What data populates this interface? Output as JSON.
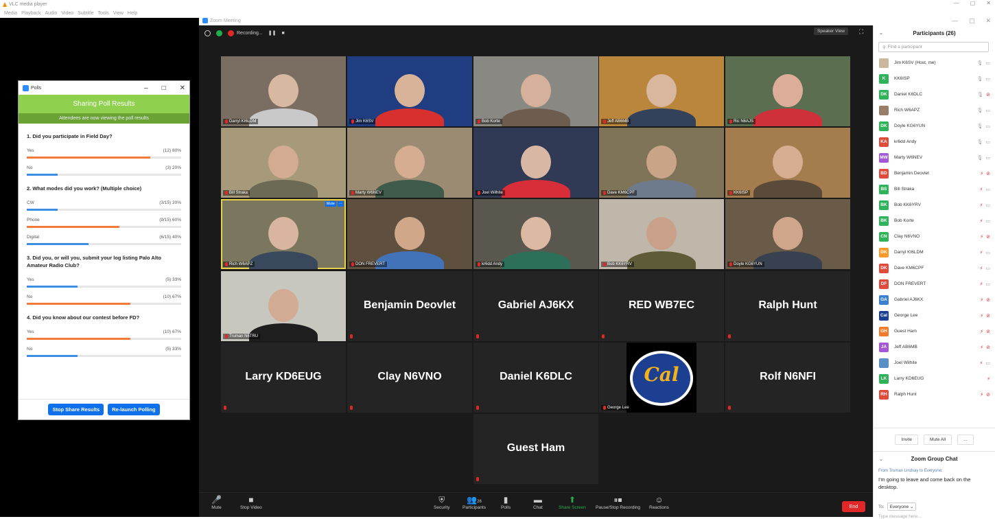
{
  "vlc": {
    "title": "VLC media player",
    "menu": [
      "Media",
      "Playback",
      "Audio",
      "Video",
      "Subtitle",
      "Tools",
      "View",
      "Help"
    ]
  },
  "polls": {
    "window_title": "Polls",
    "header": "Sharing Poll Results",
    "subheader": "Attendees are now viewing the poll results",
    "questions": [
      {
        "q": "1. Did you participate in Field Day?",
        "options": [
          {
            "label": "Yes",
            "result": "(12) 80%",
            "fraction": 0.8,
            "color": "#f27a3a"
          },
          {
            "label": "No",
            "result": "(3) 20%",
            "fraction": 0.2,
            "color": "#3a8de0"
          }
        ]
      },
      {
        "q": "2. What modes did you work? (Multiple choice)",
        "options": [
          {
            "label": "CW",
            "result": "(3/15) 20%",
            "fraction": 0.2,
            "color": "#3a8de0"
          },
          {
            "label": "Phone",
            "result": "(9/15) 60%",
            "fraction": 0.6,
            "color": "#f27a3a"
          },
          {
            "label": "Digital",
            "result": "(6/15) 40%",
            "fraction": 0.4,
            "color": "#3a8de0"
          }
        ]
      },
      {
        "q": "3. Did you, or will you, submit your log listing Palo Alto Amateur Radio Club?",
        "options": [
          {
            "label": "Yes",
            "result": "(5) 33%",
            "fraction": 0.33,
            "color": "#3a8de0"
          },
          {
            "label": "No",
            "result": "(10) 67%",
            "fraction": 0.67,
            "color": "#f27a3a"
          }
        ]
      },
      {
        "q": "4. Did you know about our contest before FD?",
        "options": [
          {
            "label": "Yes",
            "result": "(10) 67%",
            "fraction": 0.67,
            "color": "#f27a3a"
          },
          {
            "label": "No",
            "result": "(5) 33%",
            "fraction": 0.33,
            "color": "#3a8de0"
          }
        ]
      }
    ],
    "buttons": {
      "stop": "Stop Share Results",
      "relaunch": "Re-launch Polling"
    }
  },
  "zoom": {
    "window_title": "Zoom Meeting",
    "recording": "Recording...",
    "speaker_view": "Speaker View",
    "tiles": [
      {
        "type": "video",
        "name": "Darryl KI6LDM",
        "bg": "#7a6e62",
        "skin": "#d7b8a0",
        "shirt": "#c9c9c9"
      },
      {
        "type": "video",
        "name": "Jim K6SV",
        "bg": "#1f3d80",
        "skin": "#d8b39a",
        "shirt": "#d8302f"
      },
      {
        "type": "video",
        "name": "Bob Korte",
        "bg": "#8a8882",
        "skin": "#d5b09a",
        "shirt": "#6c5d4f"
      },
      {
        "type": "video",
        "name": "Jeff AB6MB",
        "bg": "#b9863c",
        "skin": "#d9b79f",
        "shirt": "#33425a"
      },
      {
        "type": "video",
        "name": "Ric N6AJS",
        "bg": "#5c6e50",
        "skin": "#dcae9a",
        "shirt": "#d0303a"
      },
      {
        "type": "video",
        "name": "Bill Straka",
        "bg": "#a79a7a",
        "skin": "#d3ab93",
        "shirt": "#6c6a55"
      },
      {
        "type": "video",
        "name": "Marty W6NEV",
        "bg": "#9b8b72",
        "skin": "#d6ad90",
        "shirt": "#3f5b4b"
      },
      {
        "type": "video",
        "name": "Joel Wilhite",
        "bg": "#303a55",
        "skin": "#d8b8a4",
        "shirt": "#d82e3a"
      },
      {
        "type": "video",
        "name": "Dave KM6CPF",
        "bg": "#807458",
        "skin": "#c9a489",
        "shirt": "#6d7b8d"
      },
      {
        "type": "video",
        "name": "KK6ISP",
        "bg": "#a47c4e",
        "skin": "#d8ae93",
        "shirt": "#5a4a3a"
      },
      {
        "type": "video",
        "name": "Rich W6APZ",
        "bg": "#7a775e",
        "skin": "#d9b4a0",
        "shirt": "#39485c",
        "active": true
      },
      {
        "type": "video",
        "name": "DON FREVERT",
        "bg": "#5f4f3f",
        "skin": "#d0a789",
        "shirt": "#4273b9"
      },
      {
        "type": "video",
        "name": "kr6dd Andy",
        "bg": "#5a574f",
        "skin": "#dbb9a2",
        "shirt": "#2e6f5a"
      },
      {
        "type": "video",
        "name": "Bob KK6YRV",
        "bg": "#bfb7a9",
        "skin": "#c9a18a",
        "shirt": "#5d5b38"
      },
      {
        "type": "video",
        "name": "Doyle KG6YUN",
        "bg": "#6a5a48",
        "skin": "#cfa58b",
        "shirt": "#37414f"
      },
      {
        "type": "video",
        "name": "Truman N6TRU",
        "bg": "#c8c7bf",
        "skin": "#d2ab95",
        "shirt": "#1e1e1e"
      },
      {
        "type": "name",
        "name": "Benjamin Deovlet"
      },
      {
        "type": "name",
        "name": "Gabriel AJ6KX"
      },
      {
        "type": "name",
        "name": "RED  WB7EC"
      },
      {
        "type": "name",
        "name": "Ralph Hunt"
      },
      {
        "type": "name",
        "name": "Larry KD6EUG"
      },
      {
        "type": "name",
        "name": "Clay  N6VNO"
      },
      {
        "type": "name",
        "name": "Daniel K6DLC"
      },
      {
        "type": "logo",
        "name": "George Lee",
        "logo": "Cal"
      },
      {
        "type": "name",
        "name": "Rolf N6NFI"
      },
      {
        "type": "name",
        "name": "Guest Ham"
      }
    ],
    "tile_mute_label": "Mute",
    "tile_more_label": "···",
    "toolbar": [
      {
        "key": "mute",
        "label": "Mute",
        "icon": "microphone-icon",
        "glyph": "🎤"
      },
      {
        "key": "stop_video",
        "label": "Stop Video",
        "icon": "video-camera-icon",
        "glyph": "■"
      },
      {
        "key": "security",
        "label": "Security",
        "icon": "shield-icon",
        "glyph": "⛨"
      },
      {
        "key": "participants",
        "label": "Participants",
        "icon": "people-icon",
        "glyph": "👥",
        "count": "26"
      },
      {
        "key": "polls",
        "label": "Polls",
        "icon": "bar-chart-icon",
        "glyph": "▮"
      },
      {
        "key": "chat",
        "label": "Chat",
        "icon": "chat-bubble-icon",
        "glyph": "▬"
      },
      {
        "key": "share",
        "label": "Share Screen",
        "icon": "share-screen-icon",
        "glyph": "⬆"
      },
      {
        "key": "record",
        "label": "Pause/Stop Recording",
        "icon": "pause-stop-icon",
        "glyph": "⏸⏹"
      },
      {
        "key": "reactions",
        "label": "Reactions",
        "icon": "smiley-icon",
        "glyph": "☺"
      }
    ],
    "end_label": "End",
    "participants_count": "26"
  },
  "participants": {
    "title": "Participants (26)",
    "search_placeholder": "Find a participant",
    "list": [
      {
        "name": "Jim K6SV (Host, me)",
        "initials": "",
        "color": "#c8b79c",
        "img": true,
        "mic": "on",
        "cam": "on"
      },
      {
        "name": "KK6ISP",
        "initials": "K",
        "color": "#2fb35a",
        "mic": "on",
        "cam": "on"
      },
      {
        "name": "Daniel K6DLC",
        "initials": "DK",
        "color": "#2fb35a",
        "mic": "on",
        "cam": "off"
      },
      {
        "name": "Rich W6APZ",
        "initials": "",
        "color": "#9a7d69",
        "img": true,
        "mic": "on",
        "cam": "on"
      },
      {
        "name": "Doyle KG6YUN",
        "initials": "DK",
        "color": "#2fb35a",
        "mic": "on",
        "cam": "on"
      },
      {
        "name": "kr6dd Andy",
        "initials": "KA",
        "color": "#e04a3d",
        "mic": "on",
        "cam": "on"
      },
      {
        "name": "Marty W6NEV",
        "initials": "MW",
        "color": "#a558d6",
        "mic": "on",
        "cam": "on"
      },
      {
        "name": "Benjamin Deovlet",
        "initials": "BD",
        "color": "#e04a3d",
        "mic": "off",
        "cam": "off"
      },
      {
        "name": "Bill Straka",
        "initials": "BS",
        "color": "#2fb35a",
        "mic": "off",
        "cam": "on"
      },
      {
        "name": "Bob KK6YRV",
        "initials": "BK",
        "color": "#2fb35a",
        "mic": "off",
        "cam": "on"
      },
      {
        "name": "Bob Korte",
        "initials": "BK",
        "color": "#2fb35a",
        "mic": "off",
        "cam": "on"
      },
      {
        "name": "Clay  N6VNO",
        "initials": "CN",
        "color": "#2fb35a",
        "mic": "off",
        "cam": "off"
      },
      {
        "name": "Darryl KI6LDM",
        "initials": "DK",
        "color": "#f79a2a",
        "mic": "off",
        "cam": "on"
      },
      {
        "name": "Dave KM6CPF",
        "initials": "DK",
        "color": "#e04a3d",
        "mic": "off",
        "cam": "on"
      },
      {
        "name": "DON FREVERT",
        "initials": "DF",
        "color": "#e04a3d",
        "mic": "off",
        "cam": "on"
      },
      {
        "name": "Gabriel AJ6KX",
        "initials": "GA",
        "color": "#3a7fd0",
        "mic": "off",
        "cam": "off"
      },
      {
        "name": "George Lee",
        "initials": "Cal",
        "color": "#1d3f92",
        "img": true,
        "mic": "off",
        "cam": "off"
      },
      {
        "name": "Guest Ham",
        "initials": "GH",
        "color": "#f07b2a",
        "mic": "off",
        "cam": "off"
      },
      {
        "name": "Jeff AB6MB",
        "initials": "JA",
        "color": "#a558d6",
        "mic": "off",
        "cam": "off"
      },
      {
        "name": "Joel Wilhite",
        "initials": "",
        "color": "#5a8fc8",
        "img": true,
        "mic": "off",
        "cam": "on"
      },
      {
        "name": "Larry KD6EUG",
        "initials": "LK",
        "color": "#2fb35a",
        "mic": "off",
        "cam": "none"
      },
      {
        "name": "Ralph Hunt",
        "initials": "RH",
        "color": "#e04a3d",
        "mic": "off",
        "cam": "off"
      }
    ],
    "invite_label": "Invite",
    "mute_all_label": "Mute All",
    "more_label": "...",
    "chat_title": "Zoom Group Chat",
    "chat_from": "From Truman Lindsay to Everyone:",
    "chat_message": "I'm going to leave and come back on the desktop.",
    "to_label": "To:",
    "to_value": "Everyone",
    "type_placeholder": "Type message here..."
  }
}
